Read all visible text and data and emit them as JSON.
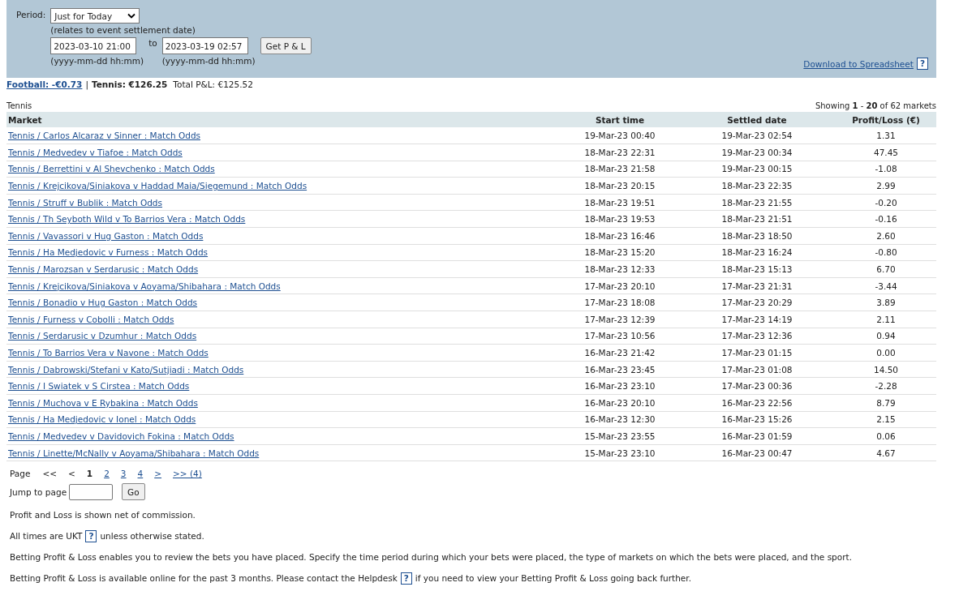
{
  "filter": {
    "period_label": "Period:",
    "period_value": "Just for Today",
    "period_note": "(relates to event settlement date)",
    "from_value": "2023-03-10 21:00",
    "to_label": "to",
    "to_value": "2023-03-19 02:57",
    "from_hint": "(yyyy-mm-dd hh:mm)",
    "to_hint": "(yyyy-mm-dd hh:mm)",
    "submit": "Get P & L",
    "download": "Download to Spreadsheet",
    "download_help": "?"
  },
  "summary": {
    "football": "Football: -€0.73",
    "separator": "|",
    "tennis": "Tennis: €126.25",
    "total": "Total P&L: €125.52"
  },
  "section_title": "Tennis",
  "showing": "Showing **1** - **20** of 62 markets",
  "table": {
    "columns": [
      "Market",
      "Start time",
      "Settled date",
      "Profit/Loss (€)"
    ],
    "rows": [
      [
        "Tennis / Carlos Alcaraz v Sinner : Match Odds",
        "19-Mar-23 00:40",
        "19-Mar-23 02:54",
        "1.31"
      ],
      [
        "Tennis / Medvedev v Tiafoe : Match Odds",
        "18-Mar-23 22:31",
        "19-Mar-23 00:34",
        "47.45"
      ],
      [
        "Tennis / Berrettini v Al Shevchenko : Match Odds",
        "18-Mar-23 21:58",
        "19-Mar-23 00:15",
        "-1.08"
      ],
      [
        "Tennis / Krejcikova/Siniakova v Haddad Maia/Siegemund : Match Odds",
        "18-Mar-23 20:15",
        "18-Mar-23 22:35",
        "2.99"
      ],
      [
        "Tennis / Struff v Bublik : Match Odds",
        "18-Mar-23 19:51",
        "18-Mar-23 21:55",
        "-0.20"
      ],
      [
        "Tennis / Th Seyboth Wild v To Barrios Vera : Match Odds",
        "18-Mar-23 19:53",
        "18-Mar-23 21:51",
        "-0.16"
      ],
      [
        "Tennis / Vavassori v Hug Gaston : Match Odds",
        "18-Mar-23 16:46",
        "18-Mar-23 18:50",
        "2.60"
      ],
      [
        "Tennis / Ha Medjedovic v Furness : Match Odds",
        "18-Mar-23 15:20",
        "18-Mar-23 16:24",
        "-0.80"
      ],
      [
        "Tennis / Marozsan v Serdarusic : Match Odds",
        "18-Mar-23 12:33",
        "18-Mar-23 15:13",
        "6.70"
      ],
      [
        "Tennis / Krejcikova/Siniakova v Aoyama/Shibahara : Match Odds",
        "17-Mar-23 20:10",
        "17-Mar-23 21:31",
        "-3.44"
      ],
      [
        "Tennis / Bonadio v Hug Gaston : Match Odds",
        "17-Mar-23 18:08",
        "17-Mar-23 20:29",
        "3.89"
      ],
      [
        "Tennis / Furness v Cobolli : Match Odds",
        "17-Mar-23 12:39",
        "17-Mar-23 14:19",
        "2.11"
      ],
      [
        "Tennis / Serdarusic v Dzumhur : Match Odds",
        "17-Mar-23 10:56",
        "17-Mar-23 12:36",
        "0.94"
      ],
      [
        "Tennis / To Barrios Vera v Navone : Match Odds",
        "16-Mar-23 21:42",
        "17-Mar-23 01:15",
        "0.00"
      ],
      [
        "Tennis / Dabrowski/Stefani v Kato/Sutjiadi : Match Odds",
        "16-Mar-23 23:45",
        "17-Mar-23 01:08",
        "14.50"
      ],
      [
        "Tennis / I Swiatek v S Cirstea : Match Odds",
        "16-Mar-23 23:10",
        "17-Mar-23 00:36",
        "-2.28"
      ],
      [
        "Tennis / Muchova v E Rybakina : Match Odds",
        "16-Mar-23 20:10",
        "16-Mar-23 22:56",
        "8.79"
      ],
      [
        "Tennis / Ha Medjedovic v Ionel : Match Odds",
        "16-Mar-23 12:30",
        "16-Mar-23 15:26",
        "2.15"
      ],
      [
        "Tennis / Medvedev v Davidovich Fokina : Match Odds",
        "15-Mar-23 23:55",
        "16-Mar-23 01:59",
        "0.06"
      ],
      [
        "Tennis / Linette/McNally v Aoyama/Shibahara : Match Odds",
        "15-Mar-23 23:10",
        "16-Mar-23 00:47",
        "4.67"
      ]
    ]
  },
  "pagination": {
    "label": "Page",
    "items": [
      {
        "text": "<<",
        "kind": "disabled"
      },
      {
        "text": "<",
        "kind": "disabled"
      },
      {
        "text": "1",
        "kind": "current"
      },
      {
        "text": "2",
        "kind": "link"
      },
      {
        "text": "3",
        "kind": "link"
      },
      {
        "text": "4",
        "kind": "link"
      },
      {
        "text": ">",
        "kind": "link"
      },
      {
        "text": ">> (4)",
        "kind": "link"
      }
    ],
    "jump_label": "Jump to page",
    "go": "Go"
  },
  "notes": [
    {
      "text": "Profit and Loss is shown net of commission."
    },
    {
      "text": "All times are UKT",
      "help": "?",
      "after": "unless otherwise stated."
    },
    {
      "text": "Betting Profit & Loss enables you to review the bets you have placed. Specify the time period during which your bets were placed, the type of markets on which the bets were placed, and the sport."
    },
    {
      "text": "Betting Profit & Loss is available online for the past 3 months. Please contact the Helpdesk",
      "help": "?",
      "after": "if you need to view your Betting Profit & Loss going back further."
    }
  ]
}
